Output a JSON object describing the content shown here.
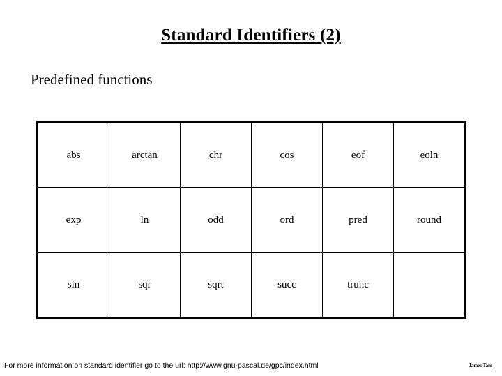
{
  "slide": {
    "title": "Standard Identifiers (2)",
    "subheading": "Predefined functions"
  },
  "table": {
    "rows": [
      [
        "abs",
        "arctan",
        "chr",
        "cos",
        "eof",
        "eoln"
      ],
      [
        "exp",
        "ln",
        "odd",
        "ord",
        "pred",
        "round"
      ],
      [
        "sin",
        "sqr",
        "sqrt",
        "succ",
        "trunc",
        ""
      ]
    ]
  },
  "footer": {
    "note": "For more information on standard identifier go to the url: http://www.gnu-pascal.de/gpc/index.html",
    "author": "James Tam"
  },
  "colors": {
    "text": "#000000",
    "background": "#ffffff",
    "border": "#000000"
  }
}
